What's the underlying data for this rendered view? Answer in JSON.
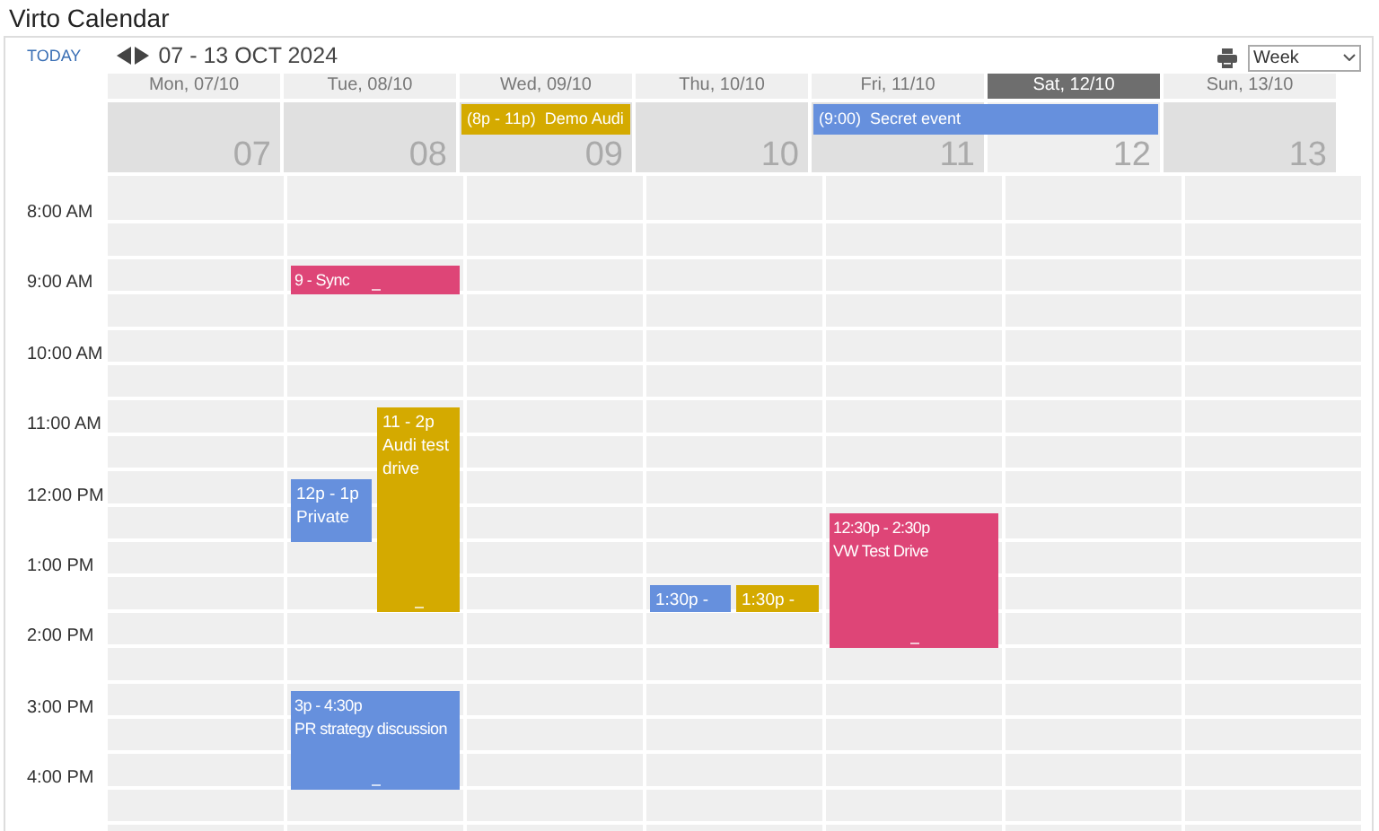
{
  "app": {
    "title": "Virto Calendar"
  },
  "toolbar": {
    "today": "TODAY",
    "range": "07 - 13 OCT 2024",
    "view": "Week"
  },
  "days": [
    {
      "label": "Mon, 07/10",
      "number": "07",
      "selected": false
    },
    {
      "label": "Tue, 08/10",
      "number": "08",
      "selected": false,
      "events": [
        {
          "time": "9 - Sync",
          "kind": "full",
          "color": "#de4577",
          "resize_grip": true
        },
        {
          "time": "11 - 2p",
          "title": "Audi test drive",
          "kind": "right",
          "color": "#d4aa00",
          "resize_grip": true
        },
        {
          "time": "12p - 1p",
          "title": "Private",
          "kind": "left",
          "color": "#6690dd",
          "resize_grip": false
        },
        {
          "time": "3p - 4:30p",
          "title": "PR strategy discussion",
          "kind": "full",
          "color": "#6690dd",
          "resize_grip": true
        }
      ]
    },
    {
      "label": "Wed, 09/10",
      "number": "09",
      "selected": false,
      "all_day_events": [
        {
          "time": "(8p - 11p)",
          "title": "Demo Audi",
          "kind": "single",
          "color": "#d4aa00"
        }
      ]
    },
    {
      "label": "Thu, 10/10",
      "number": "10",
      "selected": false,
      "events": [
        {
          "time": "1:30p -",
          "kind": "left",
          "color": "#6690dd",
          "resize_grip": false
        },
        {
          "time": "1:30p -",
          "kind": "right",
          "color": "#d4aa00",
          "resize_grip": false
        }
      ]
    },
    {
      "label": "Fri, 11/10",
      "number": "11",
      "selected": false,
      "all_day_events": [
        {
          "time": "(9:00)",
          "title": "Secret event",
          "kind": "double",
          "color": "#6690dd"
        }
      ],
      "events": [
        {
          "time": "12:30p - 2:30p",
          "title": "VW Test Drive",
          "kind": "full",
          "color": "#de4577",
          "resize_grip": true
        }
      ]
    },
    {
      "label": "Sat, 12/10",
      "number": "12",
      "selected": true
    },
    {
      "label": "Sun, 13/10",
      "number": "13",
      "selected": false
    }
  ],
  "time_labels": [
    "8:00 AM",
    "9:00 AM",
    "10:00 AM",
    "11:00 AM",
    "12:00 PM",
    "1:00 PM",
    "2:00 PM",
    "3:00 PM",
    "4:00 PM"
  ]
}
